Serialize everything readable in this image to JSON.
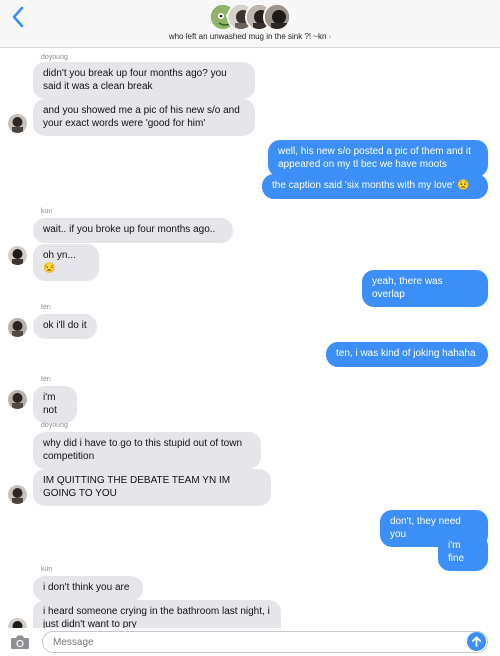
{
  "header": {
    "group_name": "who left an unwashed mug in the sink ?! ~kn",
    "chevron": "›",
    "back_icon": "chevron-left-icon",
    "accent": "#3b8ff6"
  },
  "messages": [
    {
      "sender": "doyoung",
      "side": "in",
      "text": "didn't you break up four months ago? you said it was a clean break"
    },
    {
      "side": "in",
      "text": "and you showed me a pic of his new s/o and your exact words were 'good for him'"
    },
    {
      "side": "out",
      "text": "well, his new s/o posted a pic of them and it appeared on my tl bec we have moots"
    },
    {
      "side": "out",
      "text": "the caption said 'six months with my love' 😟"
    },
    {
      "sender": "kun",
      "side": "in",
      "text": "wait.. if you broke up four months ago.."
    },
    {
      "side": "in",
      "text": "oh yn... 😒"
    },
    {
      "side": "out",
      "text": "yeah, there was overlap"
    },
    {
      "sender": "ten",
      "side": "in",
      "text": "ok i'll do it"
    },
    {
      "side": "out",
      "text": "ten, i was kind of joking hahaha"
    },
    {
      "sender": "ten",
      "side": "in",
      "text": "i'm not"
    },
    {
      "sender": "doyoung",
      "side": "in",
      "text": "why did i have to go to this stupid out of town competition"
    },
    {
      "side": "in",
      "text": "IM QUITTING THE DEBATE TEAM YN IM GOING TO YOU"
    },
    {
      "side": "out",
      "text": "don't, they need you"
    },
    {
      "side": "out",
      "text": "i'm fine"
    },
    {
      "sender": "kun",
      "side": "in",
      "text": "i don't think you are"
    },
    {
      "side": "in",
      "text": "i heard someone crying in the bathroom last night, i just didn't want to pry"
    }
  ],
  "composer": {
    "placeholder": "Message",
    "camera_icon": "camera-icon",
    "send_icon": "send-arrow-icon"
  }
}
